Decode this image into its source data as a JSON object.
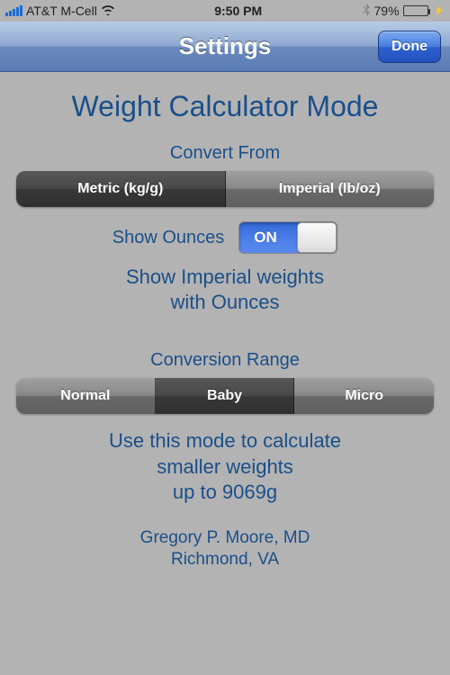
{
  "status": {
    "carrier": "AT&T M-Cell",
    "time": "9:50 PM",
    "battery_pct": "79%"
  },
  "nav": {
    "title": "Settings",
    "done": "Done"
  },
  "page_title": "Weight Calculator Mode",
  "convert_from": {
    "label": "Convert From",
    "options": [
      "Metric (kg/g)",
      "Imperial (lb/oz)"
    ],
    "selected_index": 0
  },
  "show_ounces": {
    "label": "Show Ounces",
    "state": "ON",
    "desc_line1": "Show Imperial weights",
    "desc_line2": "with Ounces"
  },
  "conversion_range": {
    "label": "Conversion Range",
    "options": [
      "Normal",
      "Baby",
      "Micro"
    ],
    "selected_index": 1,
    "desc_line1": "Use this mode to calculate",
    "desc_line2": "smaller weights",
    "desc_line3": "up to 9069g"
  },
  "credits": {
    "line1": "Gregory P. Moore, MD",
    "line2": "Richmond, VA"
  }
}
